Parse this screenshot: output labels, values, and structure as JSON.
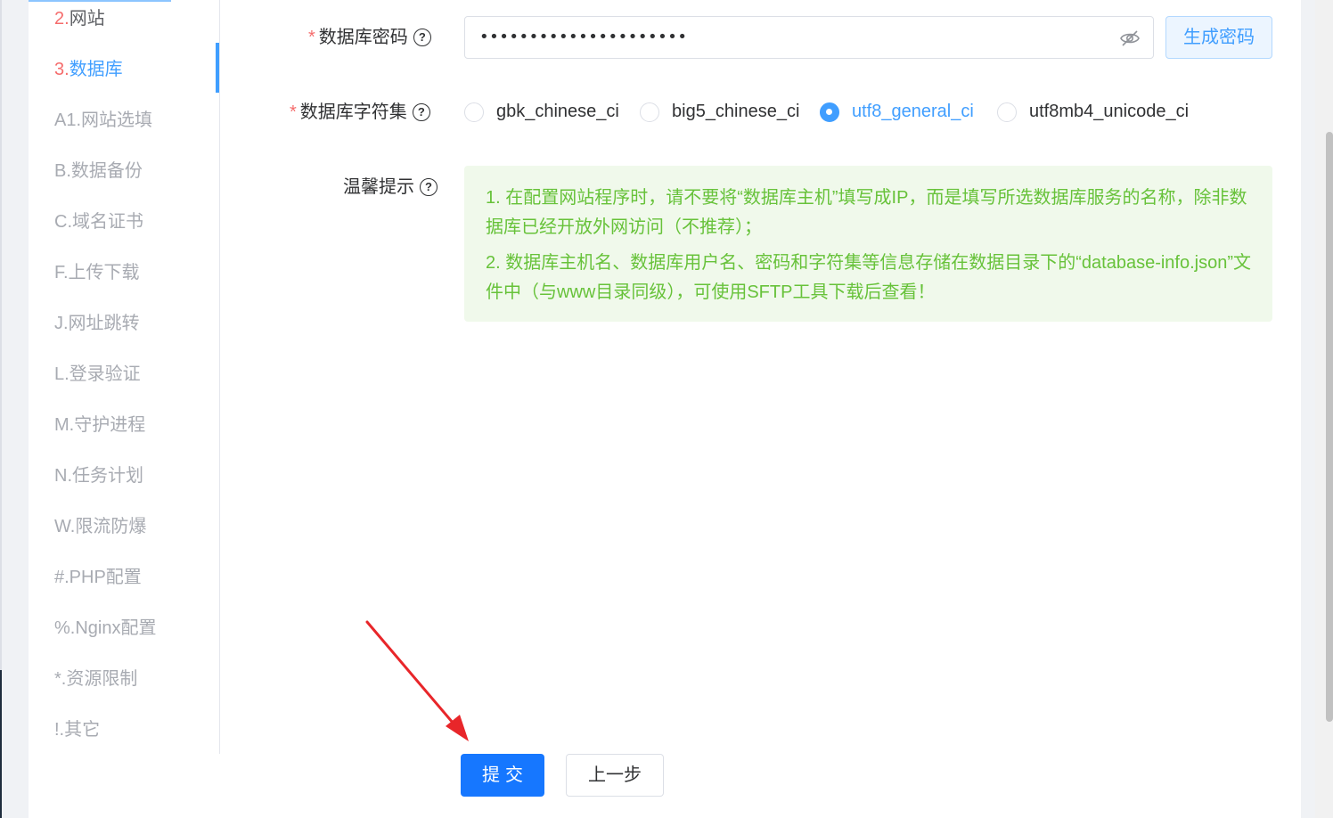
{
  "sidebar": {
    "items": [
      {
        "num": "2.",
        "label": "网站",
        "state": "done"
      },
      {
        "num": "3.",
        "label": "数据库",
        "state": "active"
      },
      {
        "label": "A1.网站选填",
        "state": "pending"
      },
      {
        "label": "B.数据备份",
        "state": "pending"
      },
      {
        "label": "C.域名证书",
        "state": "pending"
      },
      {
        "label": "F.上传下载",
        "state": "pending"
      },
      {
        "label": "J.网址跳转",
        "state": "pending"
      },
      {
        "label": "L.登录验证",
        "state": "pending"
      },
      {
        "label": "M.守护进程",
        "state": "pending"
      },
      {
        "label": "N.任务计划",
        "state": "pending"
      },
      {
        "label": "W.限流防爆",
        "state": "pending"
      },
      {
        "label": "#.PHP配置",
        "state": "pending"
      },
      {
        "label": "%.Nginx配置",
        "state": "pending"
      },
      {
        "label": "*.资源限制",
        "state": "pending"
      },
      {
        "label": "!.其它",
        "state": "pending"
      }
    ]
  },
  "form": {
    "required_mark": "*",
    "password": {
      "label": "数据库密码",
      "value": "•••••••••••••••••••••",
      "toggle_icon": "eye-off-icon",
      "generate_label": "生成密码"
    },
    "charset": {
      "label": "数据库字符集",
      "options": [
        "gbk_chinese_ci",
        "big5_chinese_ci",
        "utf8_general_ci",
        "utf8mb4_unicode_ci"
      ],
      "selected": "utf8_general_ci"
    },
    "tip": {
      "label": "温馨提示",
      "lines": [
        "1. 在配置网站程序时，请不要将“数据库主机”填写成IP，而是填写所选数据库服务的名称，除非数据库已经开放外网访问（不推荐）；",
        "2. 数据库主机名、数据库用户名、密码和字符集等信息存储在数据目录下的“database-info.json”文件中（与www目录同级），可使用SFTP工具下载后查看！"
      ]
    },
    "help_icon": "?"
  },
  "actions": {
    "submit_label": "提交",
    "prev_label": "上一步"
  },
  "colors": {
    "primary": "#409eff",
    "submit": "#1677ff",
    "required": "#f56c6c",
    "tip_text": "#67c23a",
    "tip_bg": "#f0f9eb",
    "annotation_arrow": "#e8262a"
  }
}
